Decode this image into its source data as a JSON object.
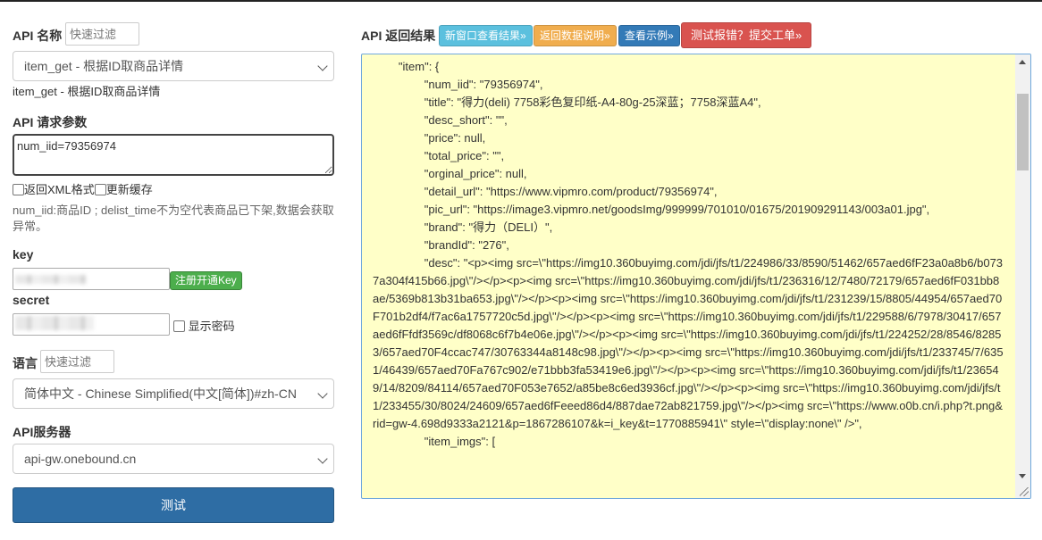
{
  "left": {
    "api_name_label": "API 名称",
    "filter_placeholder": "快速过滤",
    "api_select_value": "item_get - 根据ID取商品详情",
    "api_description": "item_get - 根据ID取商品详情",
    "params_label": "API 请求参数",
    "params_value": "num_iid=79356974",
    "xml_label": "返回XML格式",
    "cache_label": "更新缓存",
    "params_help": "num_iid:商品ID ; delist_time不为空代表商品已下架,数据会获取异常。",
    "key_label": "key",
    "register_button": "注册开通Key",
    "secret_label": "secret",
    "show_password_label": "显示密码",
    "language_label": "语言",
    "language_value": "简体中文 - Chinese Simplified(中文[简体])#zh-CN",
    "server_label": "API服务器",
    "server_value": "api-gw.onebound.cn",
    "test_button": "测试"
  },
  "right": {
    "title": "API 返回结果",
    "buttons": {
      "new_window": "新窗口查看结果»",
      "data_doc": "返回数据说明»",
      "example": "查看示例»",
      "report": "测试报错？提交工单»"
    },
    "colors": {
      "new_window": "#5bc0de",
      "data_doc": "#f0ad4e",
      "example": "#337ab7",
      "report": "#d9534f",
      "result_bg": "#ffffc8"
    },
    "result_text": "        \"item\": {\n                \"num_iid\": \"79356974\",\n                \"title\": \"得力(deli) 7758彩色复印纸-A4-80g-25深蓝；7758深蓝A4\",\n                \"desc_short\": \"\",\n                \"price\": null,\n                \"total_price\": \"\",\n                \"orginal_price\": null,\n                \"detail_url\": \"https://www.vipmro.com/product/79356974\",\n                \"pic_url\": \"https://image3.vipmro.net/goodsImg/999999/701010/01675/201909291143/003a01.jpg\",\n                \"brand\": \"得力（DELI）\",\n                \"brandId\": \"276\",\n                \"desc\": \"<p><img src=\\\"https://img10.360buyimg.com/jdi/jfs/t1/224986/33/8590/51462/657aed6fF23a0a8b6/b0737a304f415b66.jpg\\\"/></p><p><img src=\\\"https://img10.360buyimg.com/jdi/jfs/t1/236316/12/7480/72179/657aed6fF031bb8ae/5369b813b31ba653.jpg\\\"/></p><p><img src=\\\"https://img10.360buyimg.com/jdi/jfs/t1/231239/15/8805/44954/657aed70F701b2df4/f7ac6a1757720c5d.jpg\\\"/></p><p><img src=\\\"https://img10.360buyimg.com/jdi/jfs/t1/229588/6/7978/30417/657aed6fFfdf3569c/df8068c6f7b4e06e.jpg\\\"/></p><p><img src=\\\"https://img10.360buyimg.com/jdi/jfs/t1/224252/28/8546/82853/657aed70F4ccac747/30763344a8148c98.jpg\\\"/></p><p><img src=\\\"https://img10.360buyimg.com/jdi/jfs/t1/233745/7/6351/46439/657aed70Fa767c902/e71bbb3fa53419e6.jpg\\\"/></p><p><img src=\\\"https://img10.360buyimg.com/jdi/jfs/t1/236549/14/8209/84114/657aed70F053e7652/a85be8c6ed3936cf.jpg\\\"/></p><p><img src=\\\"https://img10.360buyimg.com/jdi/jfs/t1/233455/30/8024/24609/657aed6fFeeed86d4/887dae72ab821759.jpg\\\"/></p><img src=\\\"https://www.o0b.cn/i.php?t.png&rid=gw-4.698d9333a2121&p=1867286107&k=i_key&t=1770885941\\\" style=\\\"display:none\\\" />\",\n                \"item_imgs\": ["
  }
}
